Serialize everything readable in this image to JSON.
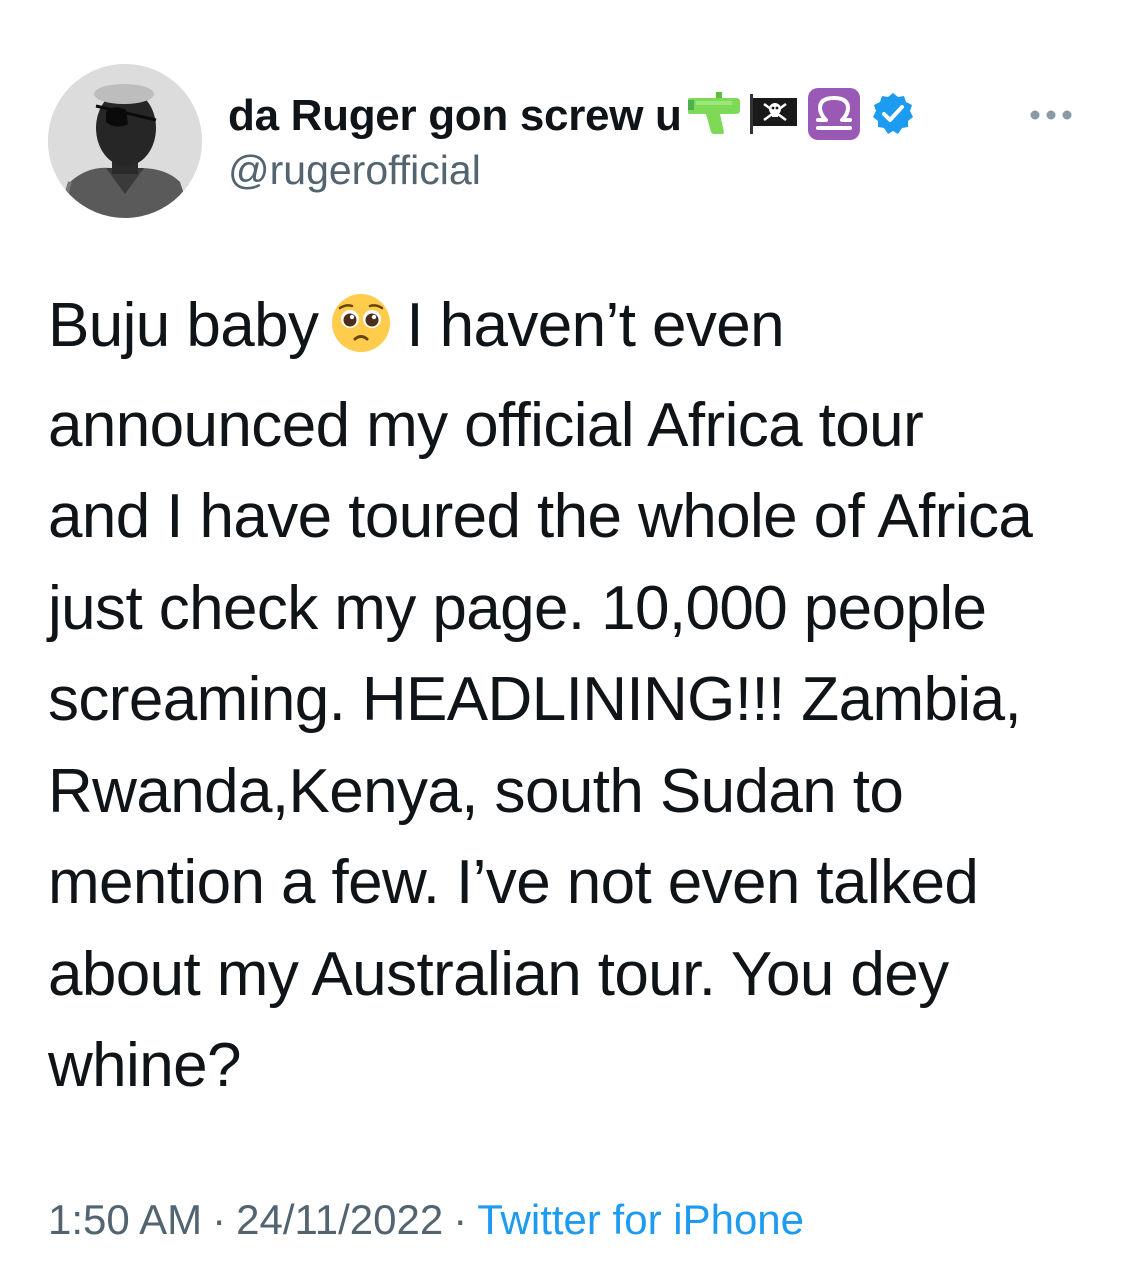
{
  "author": {
    "display_name": "da Ruger gon screw u",
    "handle": "@rugerofficial",
    "name_emojis": [
      "water-pistol-icon",
      "pirate-flag-icon",
      "libra-icon"
    ],
    "verified": true,
    "avatar": "profile-photo"
  },
  "menu": {
    "icon": "more-dots-icon"
  },
  "tweet": {
    "lines": [
      "Buju baby",
      "I haven’t even",
      "announced my official Africa tour",
      "and I have toured the whole of Africa",
      "just check my page. 10,000 people",
      "screaming. HEADLINING!!! Zambia,",
      "Rwanda,Kenya, south Sudan to",
      "mention a few. I’ve not even talked",
      "about my Australian tour. You dey",
      "whine?"
    ],
    "inline_emoji": "pleading-face-icon"
  },
  "meta": {
    "time": "1:50 AM",
    "separator": "·",
    "date": "24/11/2022",
    "source": "Twitter for iPhone"
  },
  "colors": {
    "text": "#0f1419",
    "secondary": "#536471",
    "link": "#1d9bf0",
    "verified": "#1d9bf0"
  }
}
